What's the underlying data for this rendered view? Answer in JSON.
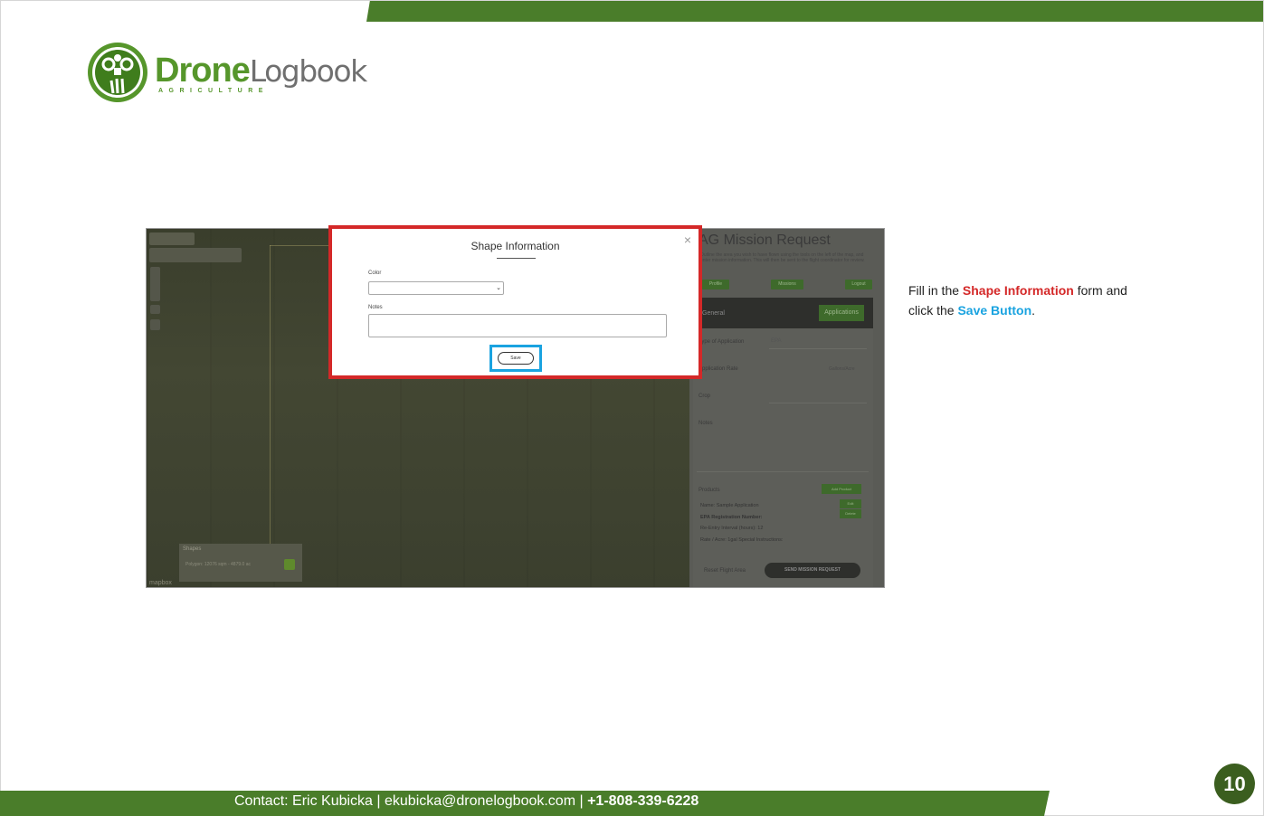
{
  "header": {
    "logo_brand_part1": "Drone",
    "logo_brand_part2": "Logbook",
    "logo_subtitle": "AGRICULTURE"
  },
  "screenshot": {
    "map": {
      "shapes_title": "Shapes",
      "shapes_item": "Polygon: 12076 sqm - 4879.0 ac",
      "attribution": "mapbox"
    },
    "sidebar": {
      "title": "AG Mission Request",
      "description": "Outline the area you wish to have flown using the tools on the left of the map, and enter mission information. This will then be sent to the flight coordinator for review.",
      "buttons": [
        "Profile",
        "Missions",
        "Logout"
      ],
      "tab_general": "General",
      "tab_applications": "Applications",
      "type_label": "Type of Application",
      "type_value": "EPA",
      "rate_label": "Application Rate",
      "rate_unit": "Gallons/Acre",
      "crop_label": "Crop",
      "notes_label": "Notes",
      "products_label": "Products",
      "add_product": "Add Product",
      "product_name": "Name: Sample Application",
      "product_epa": "EPA Registration Number:",
      "product_reentry": "Re-Entry Interval (hours): 12",
      "product_rate": "Rate / Acre: 1gal    Special Instructions:",
      "edit_btn": "Edit",
      "delete_btn": "Delete",
      "reset_link": "Reset Flight Area",
      "send_btn": "SEND MISSION REQUEST"
    },
    "modal": {
      "title": "Shape Information",
      "close": "×",
      "color_label": "Color",
      "color_value": "",
      "notes_label": "Notes",
      "notes_value": "",
      "save_label": "Save"
    }
  },
  "instruction": {
    "part1": "Fill in the ",
    "highlight1": "Shape Information",
    "part2": " form and click the ",
    "highlight2": "Save Button",
    "part3": "."
  },
  "footer": {
    "contact_prefix": "Contact: Eric Kubicka  |  ekubicka@dronelogbook.com  |  ",
    "phone": "+1-808-339-6228",
    "page_number": "10"
  },
  "colors": {
    "brand_green": "#4a7d2a",
    "highlight_red": "#d42828",
    "highlight_blue": "#1aa3e0"
  }
}
